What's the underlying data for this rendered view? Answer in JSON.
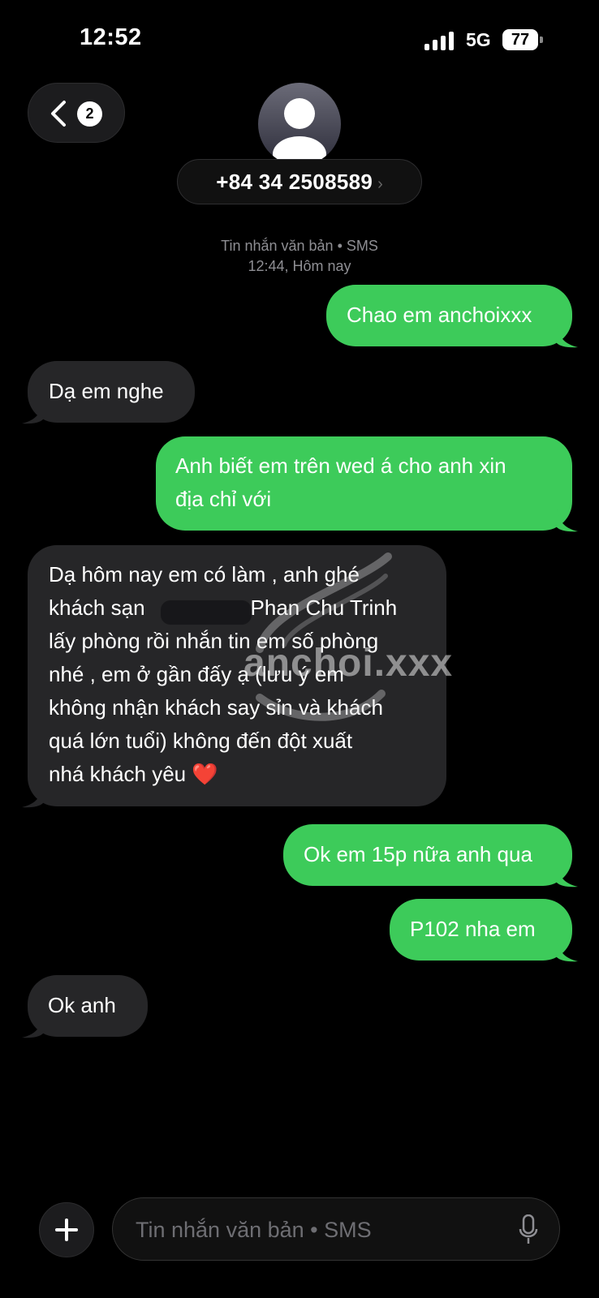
{
  "status": {
    "time": "12:52",
    "network": "5G",
    "battery": "77"
  },
  "header": {
    "unread_count": "2",
    "contact_number": "+84 34 2508589",
    "contact_arrow": "›"
  },
  "conversation": {
    "meta_line1": "Tin nhắn văn bản • SMS",
    "meta_line2": "12:44, Hôm nay",
    "messages": [
      {
        "side": "out",
        "text": "Chao em anchoixxx"
      },
      {
        "side": "in",
        "text": "Dạ em nghe"
      },
      {
        "side": "out",
        "lines": [
          "Anh biết em trên wed á cho anh xin",
          "địa chỉ với"
        ]
      },
      {
        "side": "in",
        "lines": [
          "Dạ hôm nay em có làm , anh ghé",
          "khách sạn",
          "Phan Chu Trinh",
          "lấy phòng rồi nhắn tin em số phòng",
          "nhé , em ở gần đấy ạ (lưu ý em",
          "không nhận khách say sỉn và khách",
          "quá lớn tuổi) không đến đột xuất",
          "nhá khách yêu ❤️"
        ]
      },
      {
        "side": "out",
        "text": "Ok em 15p nữa anh qua"
      },
      {
        "side": "out",
        "text": "P102 nha em"
      },
      {
        "side": "in",
        "text": "Ok anh"
      }
    ],
    "watermark": "anchoi.xxx"
  },
  "composer": {
    "placeholder": "Tin nhắn văn bản • SMS"
  }
}
